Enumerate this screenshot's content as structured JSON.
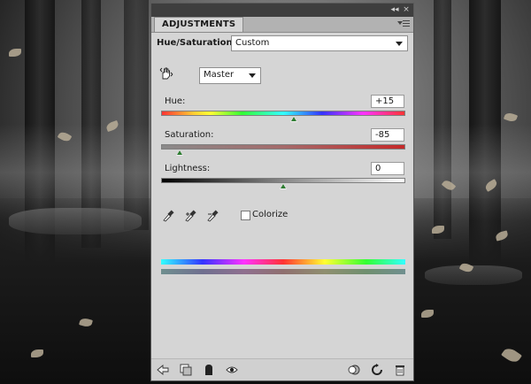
{
  "panel": {
    "tab_label": "ADJUSTMENTS",
    "controls": [
      "collapse-icon",
      "close-icon",
      "panel-menu-icon"
    ]
  },
  "hue_saturation": {
    "title": "Hue/Saturation",
    "preset": "Custom",
    "channel": "Master",
    "hue": {
      "label": "Hue:",
      "value": "+15",
      "slider_value": 15,
      "min": -180,
      "max": 180
    },
    "saturation": {
      "label": "Saturation:",
      "value": "-85",
      "slider_value": -85,
      "min": -100,
      "max": 100
    },
    "lightness": {
      "label": "Lightness:",
      "value": "0",
      "slider_value": 0,
      "min": -100,
      "max": 100
    },
    "colorize": {
      "label": "Colorize",
      "checked": false
    },
    "eyedroppers": [
      "eyedropper-icon",
      "eyedropper-plus-icon",
      "eyedropper-minus-icon"
    ]
  },
  "footer_icons": {
    "left": [
      "back-arrow-icon",
      "clip-to-layer-icon",
      "layer-mask-icon",
      "visibility-eye-icon"
    ],
    "right": [
      "view-previous-icon",
      "reset-icon",
      "trash-icon"
    ]
  },
  "colors": {
    "panel_bg": "#d5d5d5",
    "header_dark": "#3e3e3e",
    "slider_thumb": "#2e7d32",
    "saturation_bar_start": "#8a8a8a",
    "saturation_bar_end": "#c62828"
  }
}
